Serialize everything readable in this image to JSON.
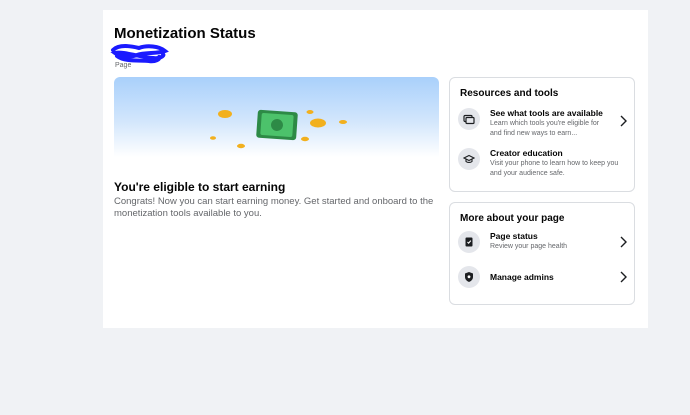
{
  "header": {
    "title": "Monetization Status",
    "page_label": "Page"
  },
  "hero": {
    "title": "You're eligible to start earning",
    "description": "Congrats! Now you can start earning money. Get started and onboard to the monetization tools available to you."
  },
  "resources": {
    "title": "Resources and tools",
    "items": [
      {
        "title": "See what tools are available",
        "subtitle": "Learn which tools you're eligible for and find new ways to earn...",
        "icon": "tools-icon"
      },
      {
        "title": "Creator education",
        "subtitle": "Visit your phone to learn how to keep you and your audience safe.",
        "icon": "graduation-cap-icon"
      }
    ]
  },
  "about": {
    "title": "More about your page",
    "items": [
      {
        "title": "Page status",
        "subtitle": "Review your page health",
        "icon": "clipboard-icon"
      },
      {
        "title": "Manage admins",
        "subtitle": "",
        "icon": "shield-icon"
      }
    ]
  },
  "colors": {
    "background": "#f0f2f5",
    "card": "#ffffff",
    "money_green": "#3aa55a",
    "coin_gold": "#f2b01e",
    "redaction_blue": "#1a1aff"
  }
}
